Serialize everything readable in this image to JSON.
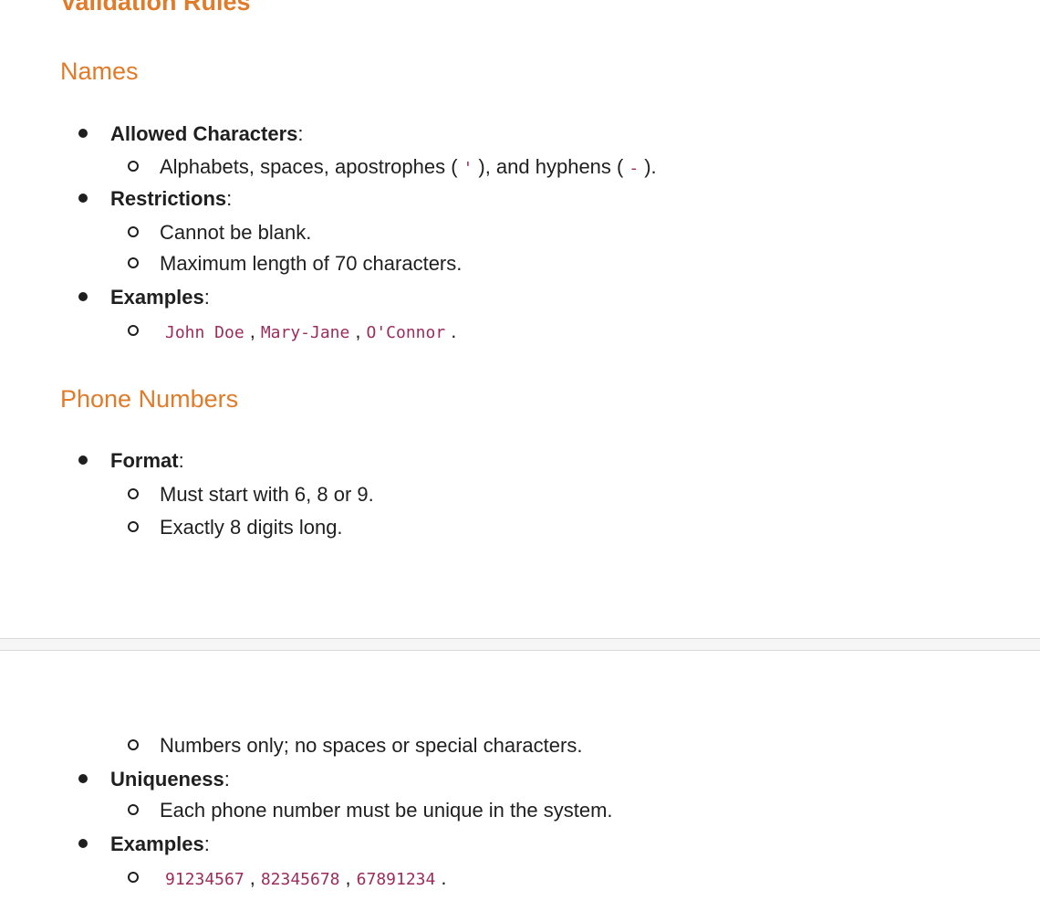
{
  "doc": {
    "title": "Validation Rules",
    "names": {
      "heading": "Names",
      "allowed_label": "Allowed Characters",
      "allowed_colon": ":",
      "allowed_text_1": "Alphabets, spaces, apostrophes (",
      "apostrophe_code": "'",
      "allowed_text_2": "), and hyphens (",
      "hyphen_code": "-",
      "allowed_text_3": ").",
      "restrictions_label": "Restrictions",
      "restrictions_colon": ":",
      "restriction_1": "Cannot be blank.",
      "restriction_2": "Maximum length of 70 characters.",
      "examples_label": "Examples",
      "examples_colon": ":",
      "example_1": "John Doe",
      "sep_1": ",",
      "example_2": "Mary-Jane",
      "sep_2": ",",
      "example_3": "O'Connor",
      "end": "."
    },
    "phone": {
      "heading": "Phone Numbers",
      "format_label": "Format",
      "format_colon": ":",
      "format_1": "Must start with 6, 8 or 9.",
      "format_2": "Exactly 8 digits long.",
      "format_3": "Numbers only; no spaces or special characters.",
      "uniqueness_label": "Uniqueness",
      "uniqueness_colon": ":",
      "uniqueness_1": "Each phone number must be unique in the system.",
      "examples_label": "Examples",
      "examples_colon": ":",
      "example_1": "91234567",
      "sep_1": ",",
      "example_2": "82345678",
      "sep_2": ",",
      "example_3": "67891234",
      "end": "."
    }
  },
  "colors": {
    "heading": "#e07b2a",
    "code": "#9b2c5c",
    "text": "#1f1f1f"
  }
}
